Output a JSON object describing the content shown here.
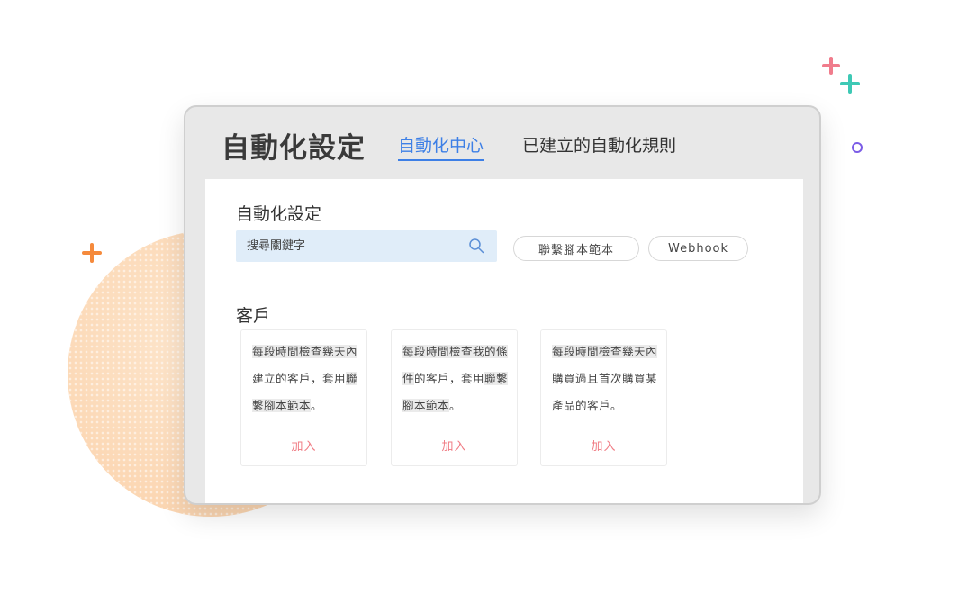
{
  "header": {
    "title": "自動化設定",
    "tabs": [
      {
        "label": "自動化中心",
        "active": true
      },
      {
        "label": "已建立的自動化規則",
        "active": false
      }
    ]
  },
  "panel": {
    "section_title": "自動化設定",
    "search": {
      "placeholder": "搜尋關鍵字",
      "icon": "search-icon"
    },
    "filters": [
      "聯繫腳本範本",
      "Webhook"
    ],
    "category": "客戶",
    "cards": [
      {
        "segments": [
          {
            "text": "每段時間檢查幾天",
            "highlight": true
          },
          {
            "text": "內",
            "highlight": true
          },
          {
            "text": "建立的客戶，套用",
            "highlight": false
          },
          {
            "text": "聯繫腳本範本",
            "highlight": true
          },
          {
            "text": "。",
            "highlight": false
          }
        ],
        "action": "加入"
      },
      {
        "segments": [
          {
            "text": "每段時間檢查我的條件",
            "highlight": true
          },
          {
            "text": "的客戶，套用",
            "highlight": false
          },
          {
            "text": "聯繫腳本範本",
            "highlight": true
          },
          {
            "text": "。",
            "highlight": false
          }
        ],
        "action": "加入"
      },
      {
        "segments": [
          {
            "text": "每段時間檢查幾天",
            "highlight": true
          },
          {
            "text": "內",
            "highlight": true
          },
          {
            "text": "購買過且首次購買某產品的客戶。",
            "highlight": false
          }
        ],
        "action": "加入"
      }
    ]
  },
  "colors": {
    "accent": "#3d7fe6",
    "add_action": "#f07c84",
    "decor_orange": "#f58a3c",
    "decor_pink": "#f07c8c",
    "decor_teal": "#3ec9b5",
    "decor_purple": "#7b5ce6"
  }
}
